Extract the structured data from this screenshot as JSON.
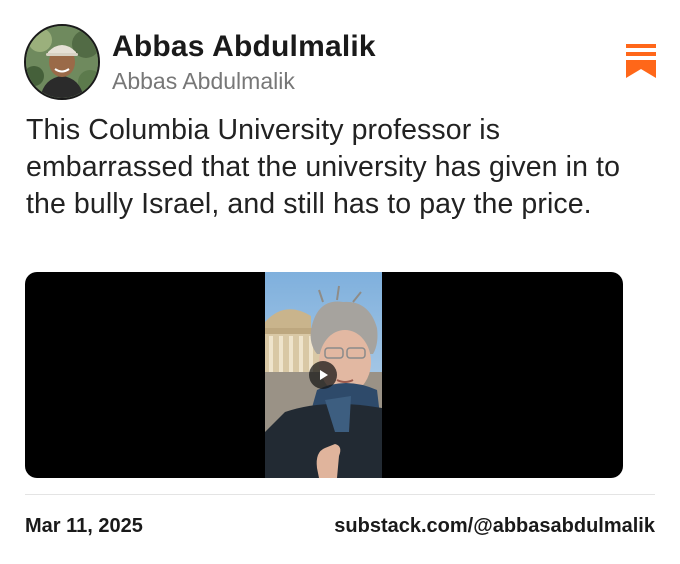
{
  "author": {
    "name": "Abbas Abdulmalik",
    "handle": "Abbas Abdulmalik",
    "avatar": "profile-photo"
  },
  "brand": {
    "icon": "substack-logo-icon",
    "color": "#ff6719"
  },
  "post": {
    "text": "This Columbia University professor is embarrassed that the university has given in to the bully Israel, and still has to pay the price.",
    "media": {
      "type": "video",
      "icon": "play-icon"
    }
  },
  "footer": {
    "date": "Mar 11, 2025",
    "source": "substack.com/@abbasabdulmalik"
  }
}
